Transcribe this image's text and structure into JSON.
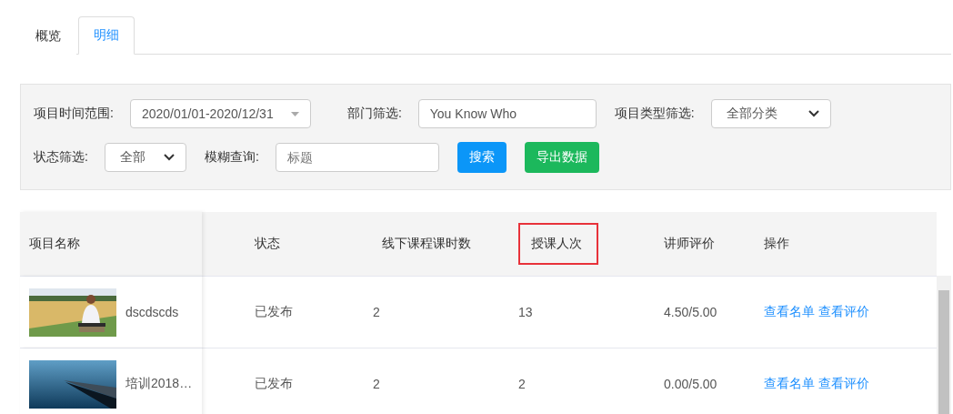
{
  "tabs": [
    {
      "label": "概览",
      "selected": false
    },
    {
      "label": "明细",
      "selected": true
    }
  ],
  "filters": [
    {
      "kind": "daterange",
      "label": "项目时间范围:",
      "value": "2020/01/01-2020/12/31"
    },
    {
      "kind": "input",
      "label": "部门筛选:",
      "value": "You Know Who"
    },
    {
      "kind": "select",
      "label": "项目类型筛选:",
      "value": "全部分类"
    },
    {
      "kind": "select",
      "label": "状态筛选:",
      "value": "全部"
    },
    {
      "kind": "input",
      "label": "模糊查询:",
      "placeholder": "标题"
    }
  ],
  "buttons": [
    {
      "label": "搜索",
      "kind": "primary"
    },
    {
      "label": "导出数据",
      "kind": "success"
    }
  ],
  "table": {
    "columns": [
      {
        "label": "项目名称",
        "highlighted": false
      },
      {
        "label": "状态",
        "highlighted": false
      },
      {
        "label": "线下课程课时数",
        "highlighted": false
      },
      {
        "label": "授课人次",
        "highlighted": true
      },
      {
        "label": "讲师评价",
        "highlighted": false
      },
      {
        "label": "操作",
        "highlighted": false
      }
    ],
    "rows": [
      {
        "name": "dscdscds",
        "status": "已发布",
        "hours": "2",
        "count": "13",
        "rating": "4.50/5.00",
        "actions": [
          "查看名单",
          "查看评价"
        ]
      },
      {
        "name": "培训2018…",
        "status": "已发布",
        "hours": "2",
        "count": "2",
        "rating": "0.00/5.00",
        "actions": [
          "查看名单",
          "查看评价"
        ]
      }
    ]
  }
}
